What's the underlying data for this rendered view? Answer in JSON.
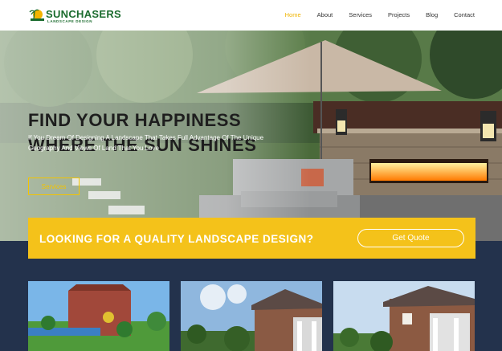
{
  "brand": {
    "name": "SUNCHASERS",
    "tagline": "LANDSCAPE DESIGN"
  },
  "nav": {
    "items": [
      {
        "label": "Home",
        "active": true
      },
      {
        "label": "About",
        "active": false
      },
      {
        "label": "Services",
        "active": false
      },
      {
        "label": "Projects",
        "active": false
      },
      {
        "label": "Blog",
        "active": false
      },
      {
        "label": "Contact",
        "active": false
      }
    ]
  },
  "hero": {
    "title_line1": "FIND YOUR HAPPINESS",
    "title_line2": "WHERE THE SUN SHINES",
    "text": "If You Dream Of Designing A Landscape That Takes Full Advantage Of The Unique Geography And Views Of Land That You Love",
    "button_label": "Services"
  },
  "cta": {
    "text": "LOOKING FOR A QUALITY LANDSCAPE DESIGN?",
    "button_label": "Get Quote"
  },
  "colors": {
    "accent": "#f4c21a",
    "brand_green": "#1a6b2d",
    "dark_section": "#23324c",
    "nav_active": "#f0b400"
  },
  "icons": {
    "logo": "sun-palm-logo-icon"
  }
}
